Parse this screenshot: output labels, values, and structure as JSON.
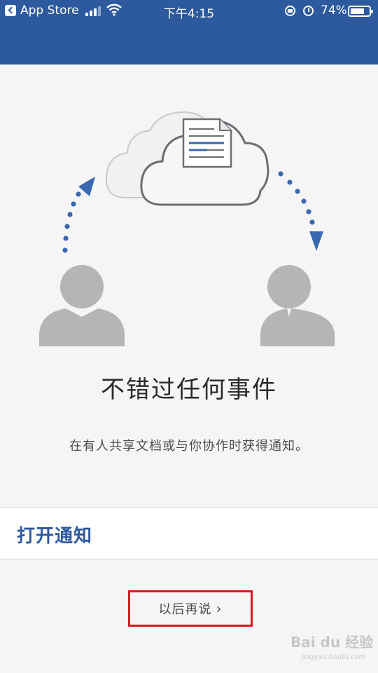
{
  "status_bar": {
    "back_app": "App Store",
    "time": "下午4:15",
    "battery_percent": "74%",
    "battery_level": 0.74
  },
  "main": {
    "title": "不错过任何事件",
    "subtitle": "在有人共享文档或与你协作时获得通知。",
    "enable_label": "打开通知",
    "later_label": "以后再说",
    "later_chevron": "›"
  },
  "watermark": {
    "text": "Bai du 经验",
    "sub": "jingyan.baidu.com"
  },
  "colors": {
    "header": "#2d5a9e",
    "accent": "#2d5a9e",
    "arrow": "#3a68b0",
    "person": "#b5b5b8",
    "highlight_box": "#e0141e"
  }
}
